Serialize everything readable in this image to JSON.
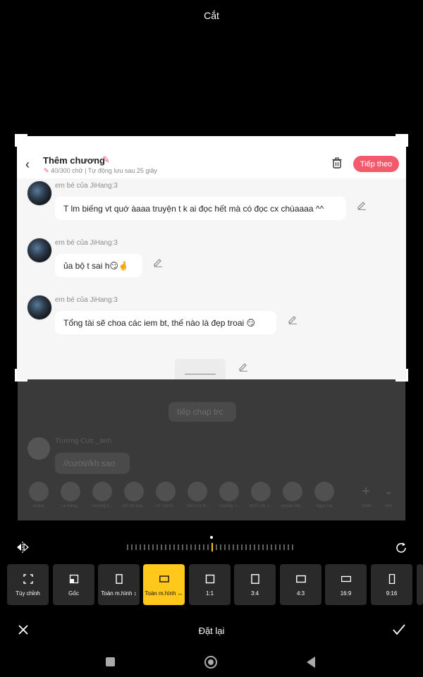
{
  "top_title": "Cắt",
  "post": {
    "title": "Thêm chương",
    "subtitle_count": "40/300 chữ",
    "subtitle_sep": " | ",
    "subtitle_autosave": "Tự động lưu sau 25 giây",
    "next_label": "Tiếp theo"
  },
  "messages": [
    {
      "author": "em bé của JiHang:3",
      "text": "T lm biếng vt quớ àaaa truyện t k ai đọc hết mà có đọc cx chùaaaa ^^"
    },
    {
      "author": "em bé của JiHang:3",
      "text": "ủa bộ t sai h😏🤞"
    },
    {
      "author": "em bé của JiHang:3",
      "text": "Tổng tài sẽ choa các iem bt, thế nào là đẹp troai 😏"
    }
  ],
  "dimmed": {
    "message1": "tiếp chap trc",
    "author2": "Trương Cực _anh",
    "message2": "//cười//kh sao",
    "row_labels": [
      "ASEK",
      "Tả Hàng...",
      "Trương C...",
      "em bé của...",
      "Tô Tân H...",
      "Chu Chí H...",
      "Trương T...",
      "Mực Chí T...",
      "Quyền Hà...",
      "Ngọc Hà",
      "Thêm",
      "Hmi"
    ]
  },
  "toolbar": {
    "ratios": [
      {
        "label": "Tùy chỉnh",
        "icon": "freeform-crop-icon",
        "selected": false
      },
      {
        "label": "Gốc",
        "icon": "original-ratio-icon",
        "selected": false
      },
      {
        "label": "Toàn m.hình ↕",
        "icon": "portrait-ratio-icon",
        "selected": false
      },
      {
        "label": "Toàn m.hình ↔",
        "icon": "landscape-ratio-icon",
        "selected": true
      },
      {
        "label": "1:1",
        "icon": "square-ratio-icon",
        "selected": false
      },
      {
        "label": "3:4",
        "icon": "ratio-3-4-icon",
        "selected": false
      },
      {
        "label": "4:3",
        "icon": "ratio-4-3-icon",
        "selected": false
      },
      {
        "label": "16:9",
        "icon": "ratio-16-9-icon",
        "selected": false
      },
      {
        "label": "9:16",
        "icon": "ratio-9-16-icon",
        "selected": false
      }
    ]
  },
  "bottom": {
    "reset_label": "Đặt lại"
  },
  "colors": {
    "accent": "#ffc81a",
    "brand": "#f35a6c"
  }
}
